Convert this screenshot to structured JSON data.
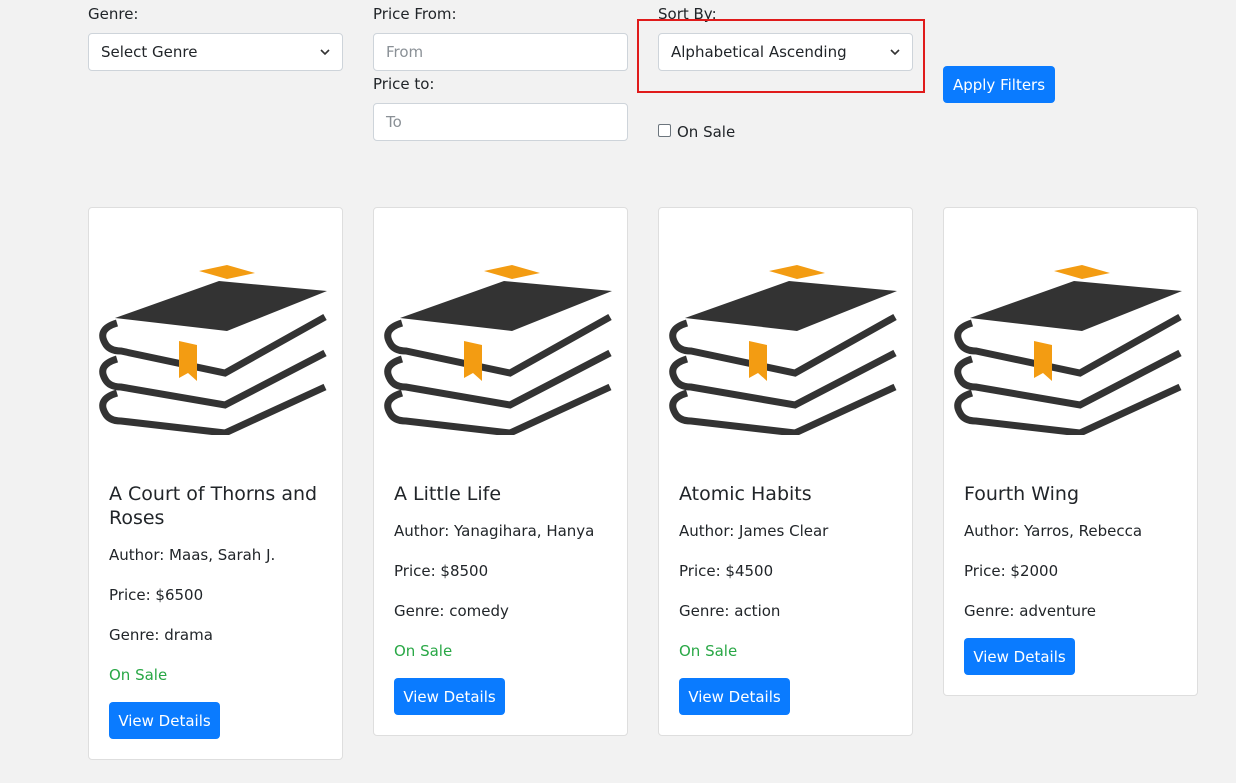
{
  "filters": {
    "genre_label": "Genre:",
    "genre_value": "Select Genre",
    "price_from_label": "Price From:",
    "price_from_placeholder": "From",
    "price_to_label": "Price to:",
    "price_to_placeholder": "To",
    "sort_label": "Sort By:",
    "sort_value": "Alphabetical Ascending",
    "on_sale_label": "On Sale",
    "on_sale_checked": false,
    "apply_label": "Apply Filters"
  },
  "colors": {
    "accent": "#0a7bff",
    "sale": "#28a745",
    "highlight": "#e01b1b",
    "book_dark": "#333333",
    "book_accent": "#f39c12"
  },
  "books": [
    {
      "title": "A Court of Thorns and Roses",
      "author": "Author: Maas, Sarah J.",
      "price": "Price: $6500",
      "genre": "Genre: drama",
      "on_sale": "On Sale",
      "button": "View Details",
      "icon": "books-stack-icon"
    },
    {
      "title": "A Little Life",
      "author": "Author: Yanagihara, Hanya",
      "price": "Price: $8500",
      "genre": "Genre: comedy",
      "on_sale": "On Sale",
      "button": "View Details",
      "icon": "books-stack-icon"
    },
    {
      "title": "Atomic Habits",
      "author": "Author: James Clear",
      "price": "Price: $4500",
      "genre": "Genre: action",
      "on_sale": "On Sale",
      "button": "View Details",
      "icon": "books-stack-icon"
    },
    {
      "title": "Fourth Wing",
      "author": "Author: Yarros, Rebecca",
      "price": "Price: $2000",
      "genre": "Genre: adventure",
      "on_sale": "",
      "button": "View Details",
      "icon": "books-stack-icon"
    }
  ]
}
